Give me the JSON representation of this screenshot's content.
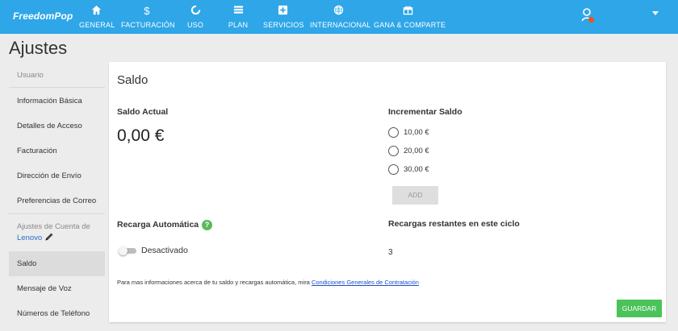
{
  "app": {
    "logo": "FreedomPop"
  },
  "nav": {
    "items": [
      {
        "label": "GENERAL",
        "icon": "home-icon"
      },
      {
        "label": "FACTURACIÓN",
        "icon": "dollar-icon"
      },
      {
        "label": "USO",
        "icon": "usage-ring-icon"
      },
      {
        "label": "PLAN",
        "icon": "list-icon"
      },
      {
        "label": "SERVICIOS",
        "icon": "plus-box-icon"
      },
      {
        "label": "INTERNACIONAL",
        "icon": "globe-icon"
      },
      {
        "label": "GANA & COMPARTE",
        "icon": "gift-icon"
      }
    ],
    "user_icon": "user-icon",
    "menu_icon": "caret-down-icon"
  },
  "page": {
    "title": "Ajustes"
  },
  "sidebar": {
    "items": [
      {
        "label": "Usuario"
      },
      {
        "label": "Información Básica"
      },
      {
        "label": "Detalles de Acceso"
      },
      {
        "label": "Facturación"
      },
      {
        "label": "Dirección de Envío"
      },
      {
        "label": "Preferencias de Correo"
      },
      {
        "label": "Ajustes de Cuenta de",
        "sub_label": "Lenovo"
      },
      {
        "label": "Saldo"
      },
      {
        "label": "Mensaje de Voz"
      },
      {
        "label": "Números de Teléfono"
      }
    ]
  },
  "balance": {
    "section_title": "Saldo",
    "current_label": "Saldo Actual",
    "current_value": "0,00 €",
    "increase_label": "Incrementar Saldo",
    "options": [
      "10,00 €",
      "20,00 €",
      "30,00 €"
    ],
    "add_button": "ADD",
    "auto_recharge_label": "Recarga Automática",
    "help_icon": "?",
    "auto_recharge_state": "Desactivado",
    "remaining_label": "Recargas restantes en este ciclo",
    "remaining_value": "3",
    "info_text": "Para mas informaciones acerca de tu saldo y recargas automática, mira",
    "info_link": "Condiciones Generales de Contratación",
    "save_button": "GUARDAR"
  },
  "colors": {
    "topbar": "#2ea6e8",
    "save_button": "#4cc25a",
    "help_icon": "#5cb85c",
    "link": "#1a4fc9",
    "active_sidebar": "#dcdcdc"
  }
}
